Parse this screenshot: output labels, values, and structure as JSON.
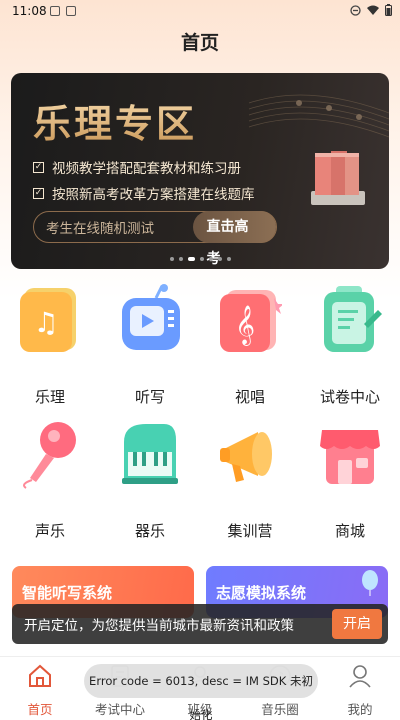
{
  "status": {
    "time": "11:08"
  },
  "header": {
    "title": "首页"
  },
  "banner": {
    "title": "乐理专区",
    "line1": "视频教学搭配配套教材和练习册",
    "line2": "按照新高考改革方案搭建在线题库",
    "pill_text": "考生在线随机测试",
    "pill_button": "直击高考"
  },
  "grid": [
    {
      "label": "乐理",
      "icon": "music-note-book-icon"
    },
    {
      "label": "听写",
      "icon": "radio-player-icon"
    },
    {
      "label": "视唱",
      "icon": "treble-clef-book-icon"
    },
    {
      "label": "试卷中心",
      "icon": "exam-paper-icon"
    },
    {
      "label": "声乐",
      "icon": "microphone-icon"
    },
    {
      "label": "器乐",
      "icon": "piano-icon"
    },
    {
      "label": "集训营",
      "icon": "megaphone-icon"
    },
    {
      "label": "商城",
      "icon": "shop-icon"
    }
  ],
  "cards": {
    "left": "智能听写系统",
    "right": "志愿模拟系统"
  },
  "toast": {
    "message": "开启定位，为您提供当前城市最新资讯和政策",
    "button": "开启"
  },
  "error": {
    "message": "Error code = 6013, desc = IM SDK 未初始化"
  },
  "tabs": [
    {
      "label": "首页",
      "icon": "home-icon"
    },
    {
      "label": "考试中心",
      "icon": "exam-icon"
    },
    {
      "label": "班级",
      "icon": "class-icon"
    },
    {
      "label": "音乐圈",
      "icon": "music-circle-icon"
    },
    {
      "label": "我的",
      "icon": "profile-icon"
    }
  ],
  "colors": {
    "accent": "#e2573a",
    "toast_button": "#f07840",
    "banner_gold": "#d9ad72"
  }
}
